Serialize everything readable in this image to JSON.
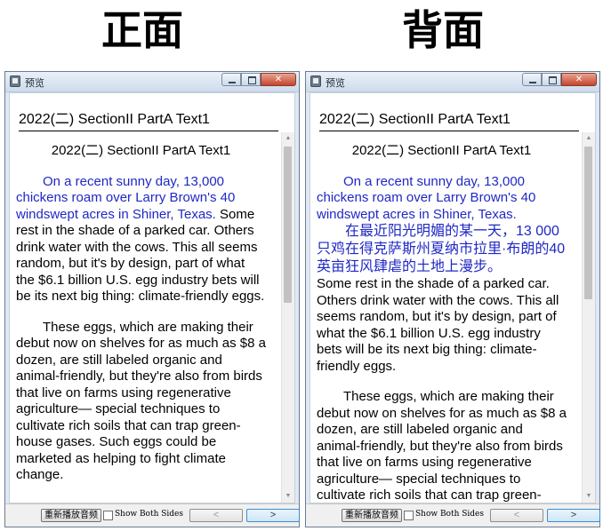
{
  "headings": {
    "front": "正面",
    "back": "背面"
  },
  "window": {
    "title": "预览",
    "doc_title": "2022(二) SectionII PartA Text1",
    "inner_title": "2022(二) SectionII PartA Text1",
    "replay_label": "重新播放音频",
    "show_both_label": "Show Both Sides",
    "prev_label": "<",
    "next_label": ">",
    "show_both_checked": false
  },
  "front": {
    "p1_blue": "On a recent sunny day, 13,000 chickens roam over Larry Brown's 40 windswept acres in Shiner, Texas.",
    "p1_rest": " Some rest in the shade of a parked car. Others drink water with the cows. This all seems random, but it's by design, part of what the $6.1 billion U.S. egg industry bets will be its next big thing: climate-friendly eggs.",
    "p2": "These eggs, which are making their debut now on shelves for as much as $8 a dozen, are still labeled organic and animal-friendly, but they're also from birds that live on farms using regenerative agriculture— special techniques to cultivate rich soils that can trap green-house gases. Such eggs could be marketed as helping to fight climate change."
  },
  "back": {
    "p1_blue": "On a recent sunny day, 13,000 chickens roam over Larry Brown's 40 windswept acres in Shiner, Texas.",
    "p1_zh": "在最近阳光明媚的某一天，13 000只鸡在得克萨斯州夏纳市拉里·布朗的40英亩狂风肆虐的土地上漫步。",
    "p1_rest": "Some rest in the shade of a parked car. Others drink water with the cows. This all seems random, but it's by design, part of what the $6.1 billion U.S. egg industry bets will be its next big thing: climate-friendly eggs.",
    "p2": "These eggs, which are making their debut now on shelves for as much as $8 a dozen, are still labeled organic and animal-friendly, but they're also from birds that live on farms using regenerative agriculture— special techniques to cultivate rich soils that can trap green-house gases."
  },
  "colors": {
    "translation_blue": "#1f28c4",
    "window_frame": "#dfe8f3"
  }
}
